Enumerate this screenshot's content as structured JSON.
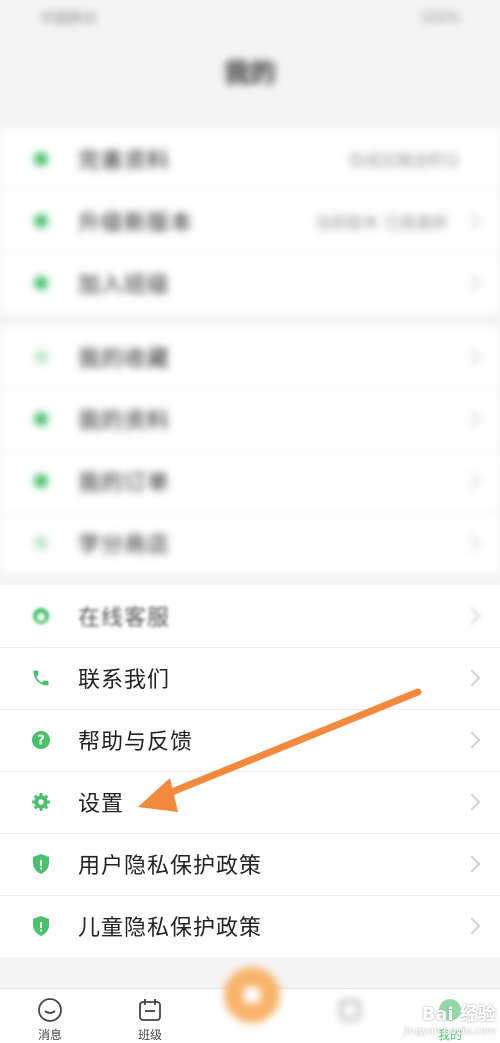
{
  "status_bar": {
    "left": "中国移动",
    "right": "100%"
  },
  "header": {
    "title": "我的"
  },
  "group1": [
    {
      "label": "完善资料",
      "value": "完成后赠送积分"
    },
    {
      "label": "升级新版本",
      "value": "当前版本 已是最新"
    },
    {
      "label": "加入班级",
      "value": ""
    }
  ],
  "group2": [
    {
      "label": "我的收藏"
    },
    {
      "label": "我的资料"
    },
    {
      "label": "我的订单"
    },
    {
      "label": "学分商店"
    }
  ],
  "group3": [
    {
      "label": "在线客服"
    },
    {
      "label": "联系我们"
    },
    {
      "label": "帮助与反馈"
    },
    {
      "label": "设置"
    },
    {
      "label": "用户隐私保护政策"
    },
    {
      "label": "儿童隐私保护政策"
    }
  ],
  "bottom_nav": {
    "items": [
      {
        "label": "消息",
        "icon": "chat-icon"
      },
      {
        "label": "班级",
        "icon": "calendar-icon"
      },
      {
        "label": "",
        "icon": "center-fab-icon"
      },
      {
        "label": "",
        "icon": "discover-icon"
      },
      {
        "label": "我的",
        "icon": "user-icon"
      }
    ]
  },
  "watermark": {
    "brand": "Bai 经验",
    "url": "jingyan.baidu.com"
  },
  "colors": {
    "accent_green": "#47c26b",
    "arrow_orange": "#f2893d",
    "fab_orange": "#f7b36a"
  }
}
